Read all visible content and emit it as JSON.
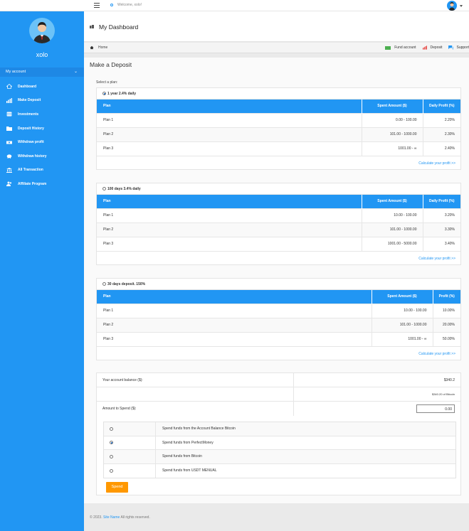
{
  "topbar": {
    "welcome": "Welcome, xolo!"
  },
  "sidebar": {
    "username": "xolo",
    "account_label": "My account",
    "items": [
      {
        "label": "Dashboard",
        "icon": "home-icon"
      },
      {
        "label": "Make Deposit",
        "icon": "bar-chart-icon"
      },
      {
        "label": "Investments",
        "icon": "database-icon"
      },
      {
        "label": "Deposit History",
        "icon": "folder-icon"
      },
      {
        "label": "Withdraw profit",
        "icon": "money-icon"
      },
      {
        "label": "Withdraw history",
        "icon": "piggy-bank-icon"
      },
      {
        "label": "All Transaction",
        "icon": "bank-icon"
      },
      {
        "label": "Affiliate Program",
        "icon": "users-icon"
      }
    ]
  },
  "header": {
    "title": "My Dashboard"
  },
  "breadcrumb": {
    "home": "Home",
    "fund": "Fund account",
    "deposit": "Deposit",
    "support": "Support"
  },
  "page": {
    "heading": "Make a Deposit",
    "select_label": "Select a plan:"
  },
  "plans": [
    {
      "name": "1 year 2.4% daily",
      "selected": true,
      "headers": [
        "Plan",
        "Spent Amount ($)",
        "Daily Profit (%)"
      ],
      "rows": [
        [
          "Plan 1",
          "0.00 - 100.00",
          "2.20%"
        ],
        [
          "Plan 2",
          "101.00 - 1000.00",
          "2.30%"
        ],
        [
          "Plan 3",
          "1001.00 - ∞",
          "2.40%"
        ]
      ],
      "calc": "Calculate your profit >>"
    },
    {
      "name": "100 days 3.4% daily",
      "selected": false,
      "headers": [
        "Plan",
        "Spent Amount ($)",
        "Daily Profit (%)"
      ],
      "rows": [
        [
          "Plan 1",
          "10.00 - 100.00",
          "3.20%"
        ],
        [
          "Plan 2",
          "101.00 - 1000.00",
          "3.30%"
        ],
        [
          "Plan 3",
          "1001.00 - 5000.00",
          "3.40%"
        ]
      ],
      "calc": "Calculate your profit >>"
    },
    {
      "name": "30 days deposit. 150%",
      "selected": false,
      "headers": [
        "Plan",
        "Spent Amount ($)",
        "Profit (%)"
      ],
      "rows": [
        [
          "Plan 1",
          "10.00 - 100.00",
          "10.00%"
        ],
        [
          "Plan 2",
          "101.00 - 1000.00",
          "20.00%"
        ],
        [
          "Plan 3",
          "1001.00 - ∞",
          "50.00%"
        ]
      ],
      "calc": "Calculate your profit >>"
    }
  ],
  "balance": {
    "label": "Your account balance ($):",
    "value": "$340.2",
    "bitcoin": "$340.20 of Bitcoin",
    "amount_label": "Amount to Spend ($):",
    "amount_value": "0.00",
    "options": [
      {
        "label": "Spend funds from the Account Balance Bitcoin",
        "selected": false
      },
      {
        "label": "Spend funds from PerfectMoney",
        "selected": true
      },
      {
        "label": "Spend funds from Bitcoin",
        "selected": false
      },
      {
        "label": "Spend funds from USDT MENUAL",
        "selected": false
      }
    ],
    "button": "Spend"
  },
  "footer": {
    "prefix": "© 2023.",
    "link": "Site Name",
    "suffix": "All rights reserved."
  }
}
